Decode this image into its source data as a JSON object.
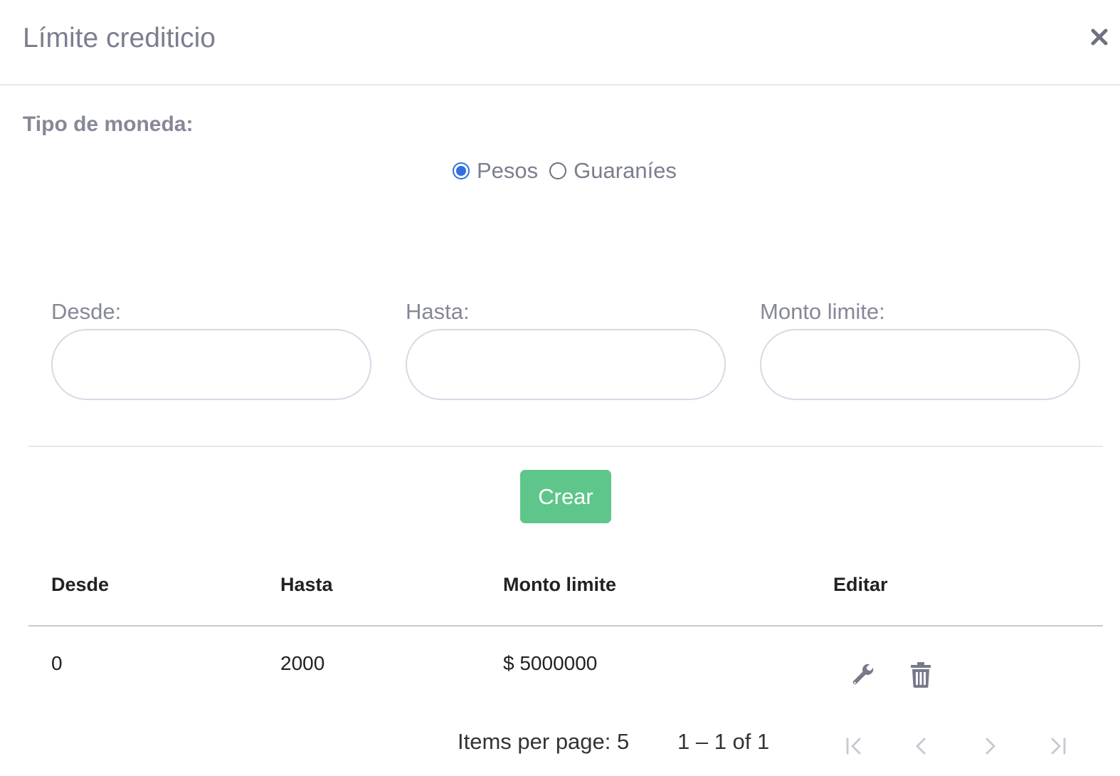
{
  "modal": {
    "title": "Límite crediticio",
    "close_icon": "close-icon"
  },
  "currency": {
    "label": "Tipo de moneda:",
    "options": [
      {
        "label": "Pesos",
        "selected": true
      },
      {
        "label": "Guaraníes",
        "selected": false
      }
    ],
    "accent_color": "#2f6fe0"
  },
  "form": {
    "fields": [
      {
        "label": "Desde:",
        "value": "",
        "placeholder": ""
      },
      {
        "label": "Hasta:",
        "value": "",
        "placeholder": ""
      },
      {
        "label": "Monto limite:",
        "value": "",
        "placeholder": ""
      }
    ],
    "create_label": "Crear",
    "create_color": "#5ec68a"
  },
  "table": {
    "columns": [
      "Desde",
      "Hasta",
      "Monto limite",
      "Editar"
    ],
    "rows": [
      {
        "desde": "0",
        "hasta": "2000",
        "monto": "$ 5000000",
        "actions": [
          "wrench-icon",
          "trash-icon"
        ]
      }
    ]
  },
  "paginator": {
    "items_per_page": "Items per page: 5",
    "range": "1 – 1 of 1",
    "buttons": [
      "first-page-icon",
      "previous-page-icon",
      "next-page-icon",
      "last-page-icon"
    ]
  }
}
